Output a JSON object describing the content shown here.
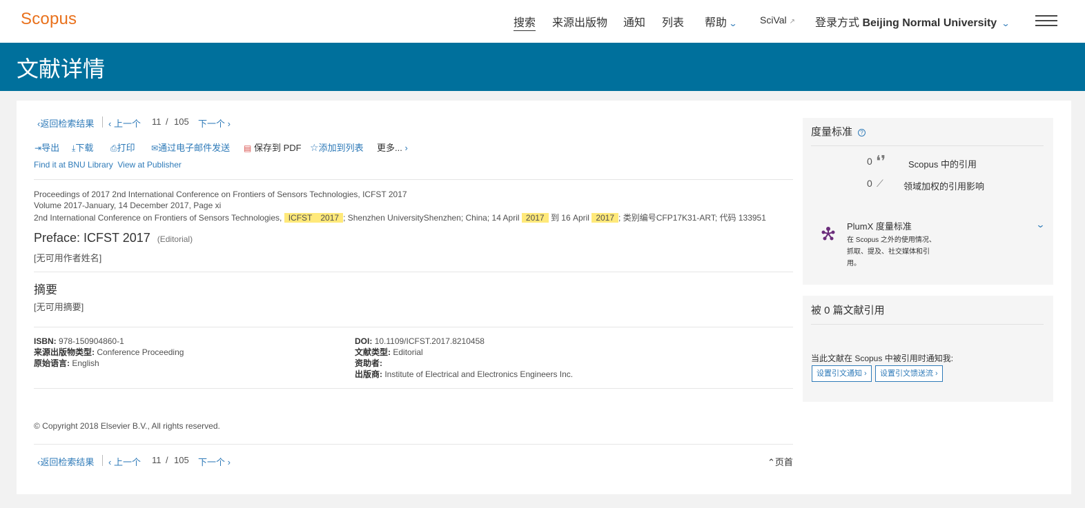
{
  "header": {
    "logo": "Scopus",
    "nav": {
      "search": "搜索",
      "sources": "来源出版物",
      "alerts": "通知",
      "lists": "列表",
      "help": "帮助",
      "scival": "SciVal",
      "login_prefix": "登录方式",
      "login_inst": "Beijing Normal University"
    }
  },
  "banner": {
    "title": "文献详情"
  },
  "pager": {
    "back": "返回检索结果",
    "prev": "上一个",
    "current": "11",
    "slash": "/",
    "total": "105",
    "next": "下一个"
  },
  "toolbar": {
    "export": "导出",
    "download": "下载",
    "print": "打印",
    "email": "通过电子邮件发送",
    "save_pdf": "保存到 PDF",
    "add_list": "添加到列表",
    "more": "更多..."
  },
  "links": {
    "find_bnu": "Find it at BNU Library",
    "view_publisher": "View at Publisher"
  },
  "source": {
    "line1": "Proceedings of 2017 2nd International Conference on Frontiers of Sensors Technologies, ICFST 2017",
    "line2": "Volume 2017-January, 14 December 2017, Page xi",
    "line3_a": "2nd International Conference on Frontiers of Sensors Technologies,",
    "hl1": "ICFST",
    "hl2": "2017",
    "line3_b": "; Shenzhen UniversityShenzhen; China; 14 April",
    "hl3": "2017",
    "line3_c": "到 16 April",
    "hl4": "2017",
    "line3_d": "; 类别编号CFP17K31-ART; 代码 133951"
  },
  "document": {
    "title": "Preface: ICFST 2017",
    "doc_type": "(Editorial)",
    "authors": "[无可用作者姓名]",
    "abstract_heading": "摘要",
    "abstract": "[无可用摘要]"
  },
  "metadata": {
    "isbn_label": "ISBN:",
    "isbn": "978-150904860-1",
    "source_type_label": "来源出版物类型:",
    "source_type": "Conference Proceeding",
    "language_label": "原始语言:",
    "language": "English",
    "doi_label": "DOI:",
    "doi": "10.1109/ICFST.2017.8210458",
    "doc_type_label": "文献类型:",
    "doc_type": "Editorial",
    "sponsor_label": "资助者:",
    "publisher_label": "出版商:",
    "publisher": "Institute of Electrical and Electronics Engineers Inc."
  },
  "footer": {
    "copyright": "© Copyright 2018 Elsevier B.V., All rights reserved.",
    "top": "页首"
  },
  "sidebar": {
    "metrics_title": "度量标准",
    "citations_count": "0",
    "citations_label": "Scopus 中的引用",
    "fwci_count": "0",
    "fwci_label": "领域加权的引用影响",
    "plumx_title": "PlumX 度量标准",
    "plumx_desc": "在 Scopus 之外的使用情况、抓取、提及、社交媒体和引用。",
    "cited_title": "被 0 篇文献引用",
    "notify_text": "当此文献在 Scopus 中被引用时通知我:",
    "btn_alert": "设置引文通知",
    "btn_feed": "设置引文馈送流"
  }
}
